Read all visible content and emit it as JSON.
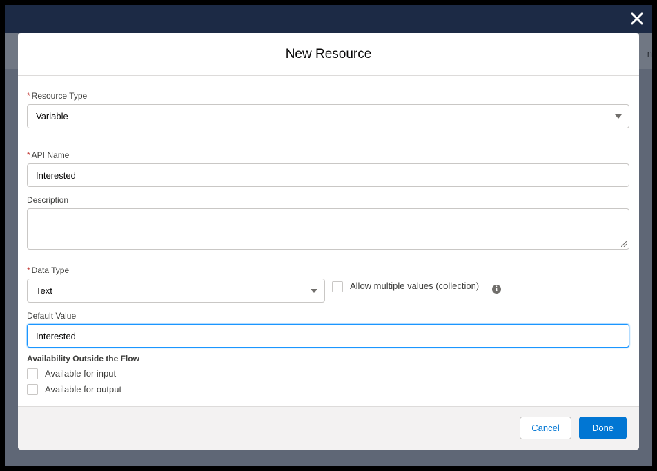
{
  "modal": {
    "title": "New Resource"
  },
  "backdrop": {
    "partial_text": "n"
  },
  "resource_type": {
    "label": "Resource Type",
    "required_marker": "*",
    "value": "Variable"
  },
  "api_name": {
    "label": "API Name",
    "required_marker": "*",
    "value": "Interested"
  },
  "description": {
    "label": "Description",
    "value": ""
  },
  "data_type": {
    "label": "Data Type",
    "required_marker": "*",
    "value": "Text"
  },
  "allow_multiple": {
    "label": "Allow multiple values (collection)",
    "checked": false
  },
  "default_value": {
    "label": "Default Value",
    "value": "Interested"
  },
  "availability": {
    "heading": "Availability Outside the Flow",
    "input_label": "Available for input",
    "output_label": "Available for output"
  },
  "footer": {
    "cancel_label": "Cancel",
    "done_label": "Done"
  },
  "icons": {
    "close": "close-icon",
    "info": "info-icon",
    "dropdown": "chevron-down-icon"
  },
  "colors": {
    "brand": "#0176d3",
    "header_bar": "#1c2a45",
    "required": "#c23934",
    "focus": "#1b96ff"
  }
}
